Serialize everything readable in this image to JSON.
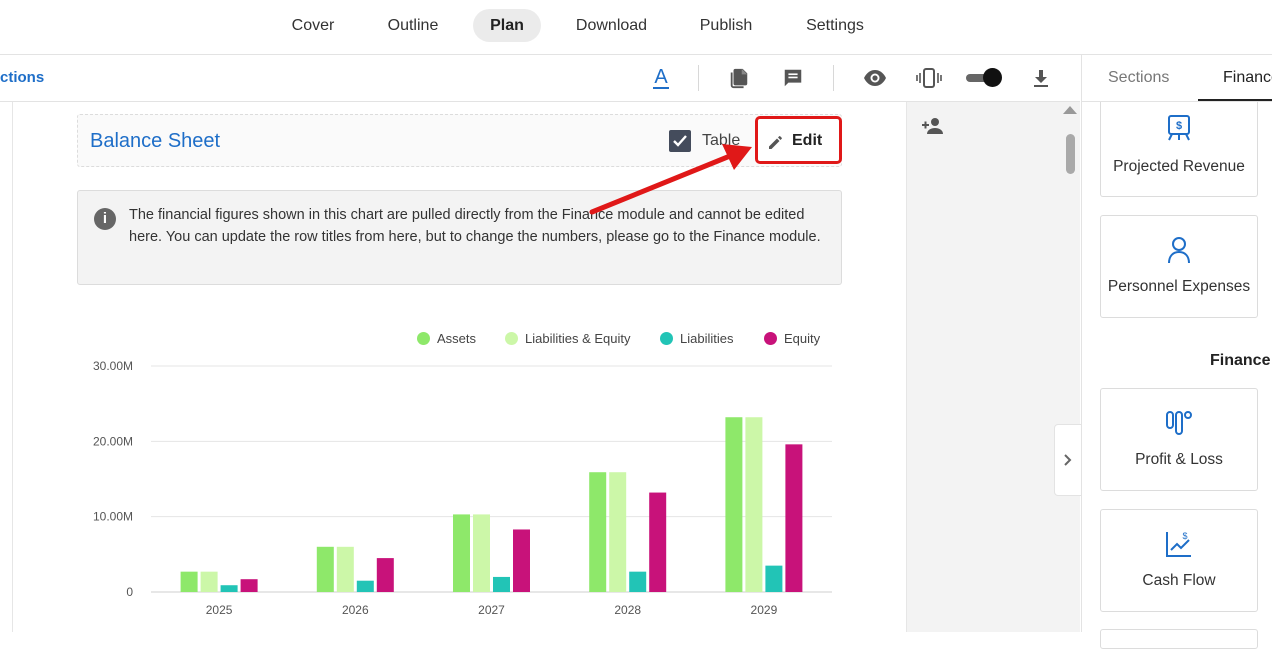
{
  "nav": {
    "tabs": [
      {
        "label": "Cover"
      },
      {
        "label": "Outline"
      },
      {
        "label": "Plan"
      },
      {
        "label": "Download"
      },
      {
        "label": "Publish"
      },
      {
        "label": "Settings"
      }
    ],
    "active": "Plan"
  },
  "toolbar": {
    "sections_link": "ctions",
    "icons": [
      "text-format-icon",
      "document-icon",
      "comment-icon",
      "eye-icon",
      "mobile-view-icon",
      "toggle-switch",
      "download-icon"
    ],
    "toggle_on": true
  },
  "section": {
    "title": "Balance Sheet",
    "table_label": "Table",
    "table_checked": true,
    "edit_label": "Edit"
  },
  "info": {
    "text": "The financial figures shown in this chart are pulled directly from the Finance module and cannot be edited here. You can update the row titles from here, but to change the numbers, please go to the Finance module."
  },
  "colors": {
    "accent_blue": "#1e6ec8",
    "annotation_red": "#e01818"
  },
  "chart_data": {
    "type": "bar",
    "title": "",
    "xlabel": "",
    "ylabel": "",
    "categories": [
      "2025",
      "2026",
      "2027",
      "2028",
      "2029"
    ],
    "ylim": [
      0,
      30000000
    ],
    "yticks": [
      {
        "value": 0,
        "label": "0"
      },
      {
        "value": 10000000,
        "label": "10.00M"
      },
      {
        "value": 20000000,
        "label": "20.00M"
      },
      {
        "value": 30000000,
        "label": "30.00M"
      }
    ],
    "grid": true,
    "legend_position": "top-right",
    "series": [
      {
        "name": "Assets",
        "color": "#8ee86a",
        "values": [
          2700000,
          6000000,
          10300000,
          15900000,
          23200000
        ]
      },
      {
        "name": "Liabilities & Equity",
        "color": "#ccf7a8",
        "values": [
          2700000,
          6000000,
          10300000,
          15900000,
          23200000
        ]
      },
      {
        "name": "Liabilities",
        "color": "#22c4b6",
        "values": [
          900000,
          1500000,
          2000000,
          2700000,
          3500000
        ]
      },
      {
        "name": "Equity",
        "color": "#c8127a",
        "values": [
          1700000,
          4500000,
          8300000,
          13200000,
          19600000
        ]
      }
    ]
  },
  "right_panel": {
    "tabs": [
      {
        "label": "Sections"
      },
      {
        "label": "Finance"
      }
    ],
    "active_tab": "Finance",
    "cards_top": [
      {
        "label": "Projected Revenue",
        "icon": "revenue-icon"
      },
      {
        "label": "Personnel Expenses",
        "icon": "person-icon"
      }
    ],
    "heading": "Finance",
    "cards_bottom": [
      {
        "label": "Profit & Loss",
        "icon": "profit-loss-icon"
      },
      {
        "label": "Cash Flow",
        "icon": "cash-flow-icon"
      }
    ]
  }
}
